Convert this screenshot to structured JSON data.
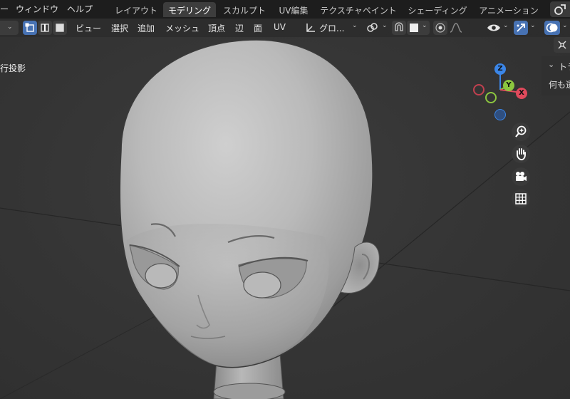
{
  "menu": {
    "window": "ウィンドウ",
    "help": "ヘルプ"
  },
  "workspace_tabs": [
    {
      "label": "レイアウト",
      "active": false
    },
    {
      "label": "モデリング",
      "active": true
    },
    {
      "label": "スカルプト",
      "active": false
    },
    {
      "label": "UV編集",
      "active": false
    },
    {
      "label": "テクスチャペイント",
      "active": false
    },
    {
      "label": "シェーディング",
      "active": false
    },
    {
      "label": "アニメーション",
      "active": false
    }
  ],
  "header": {
    "view": "ビュー",
    "select": "選択",
    "add": "追加",
    "mesh": "メッシュ",
    "vertex": "頂点",
    "edge": "辺",
    "face": "面",
    "uv": "UV",
    "orientation": "グロ..."
  },
  "viewport": {
    "projection_label": "行投影"
  },
  "gizmo": {
    "z": "Z",
    "y": "Y",
    "x": "X"
  },
  "side_panel": {
    "title": "トラ",
    "message": "何も選"
  },
  "colors": {
    "accent_blue": "#4772b3",
    "axis_x": "#e04a5c",
    "axis_y": "#8cc63f",
    "axis_z": "#3b86e8"
  }
}
